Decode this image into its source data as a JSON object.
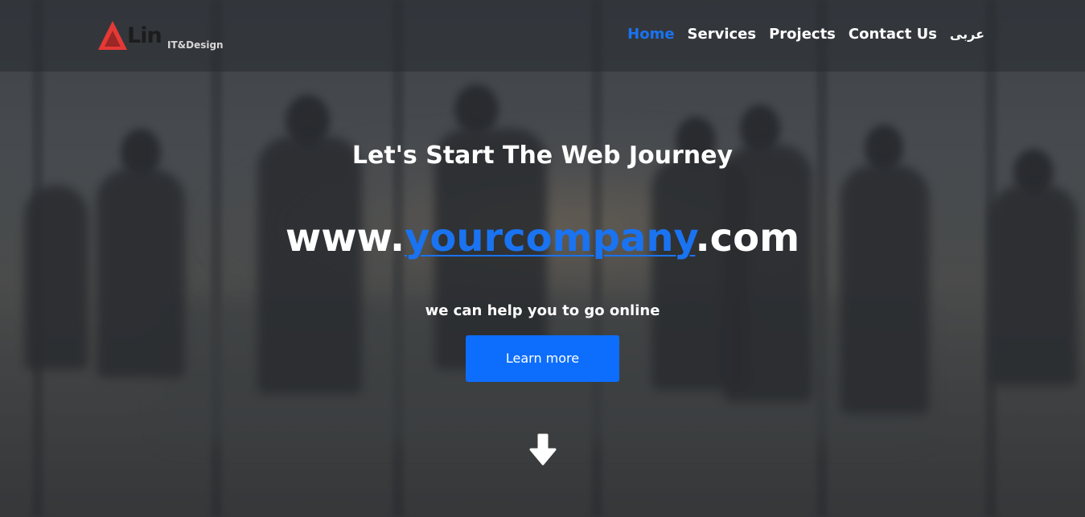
{
  "brand": {
    "logo_word": "Lin",
    "logo_sub": "IT&Design",
    "accent_color": "#e53935"
  },
  "nav": {
    "items": [
      {
        "label": "Home",
        "active": true
      },
      {
        "label": "Services",
        "active": false
      },
      {
        "label": "Projects",
        "active": false
      },
      {
        "label": "Contact Us",
        "active": false
      },
      {
        "label": "عربى",
        "active": false
      }
    ],
    "active_color": "#1a73f0"
  },
  "hero": {
    "tagline": "Let's Start The Web Journey",
    "domain_prefix": "www.",
    "domain_link": "yourcompany",
    "domain_suffix": ".com",
    "subtext": "we can help you to go online",
    "cta_label": "Learn more",
    "cta_color": "#0d6efd",
    "scroll_icon": "arrow-down-icon"
  }
}
